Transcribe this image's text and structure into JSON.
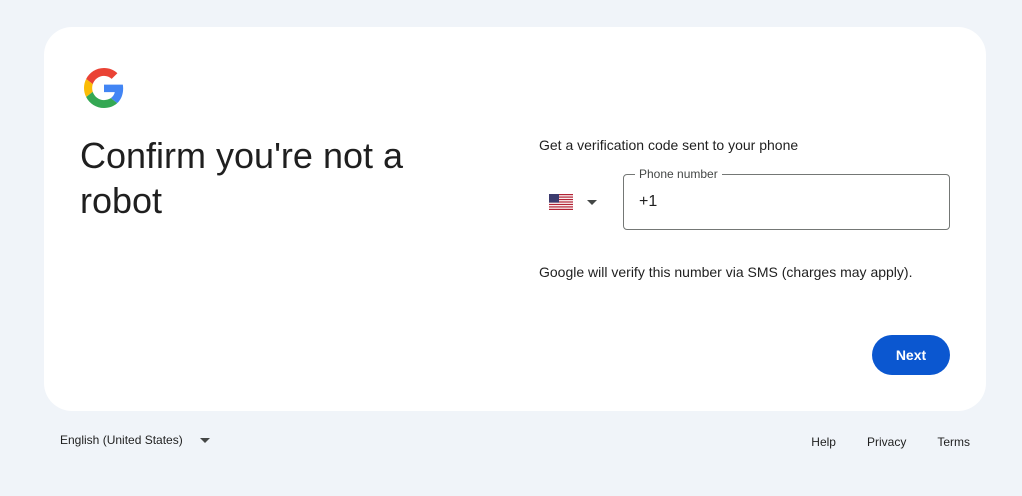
{
  "page": {
    "headline": "Confirm you're not a robot"
  },
  "logo": {
    "icon": "google-g-icon",
    "colors": {
      "blue": "#4285F4",
      "red": "#EA4335",
      "yellow": "#FBBC05",
      "green": "#34A853"
    }
  },
  "form": {
    "prompt": "Get a verification code sent to your phone",
    "country": {
      "flag_icon": "us-flag-icon",
      "dropdown_icon": "caret-down-icon"
    },
    "phone_field": {
      "label": "Phone number",
      "value": "+1"
    },
    "helper_text": "Google will verify this number via SMS (charges may apply).",
    "next_label": "Next"
  },
  "footer": {
    "language": "English (United States)",
    "language_dropdown_icon": "caret-down-icon",
    "links": [
      "Help",
      "Privacy",
      "Terms"
    ]
  },
  "colors": {
    "page_background": "#f0f4f9",
    "card_background": "#ffffff",
    "primary_button": "#0b57d0",
    "field_border": "#747775"
  }
}
